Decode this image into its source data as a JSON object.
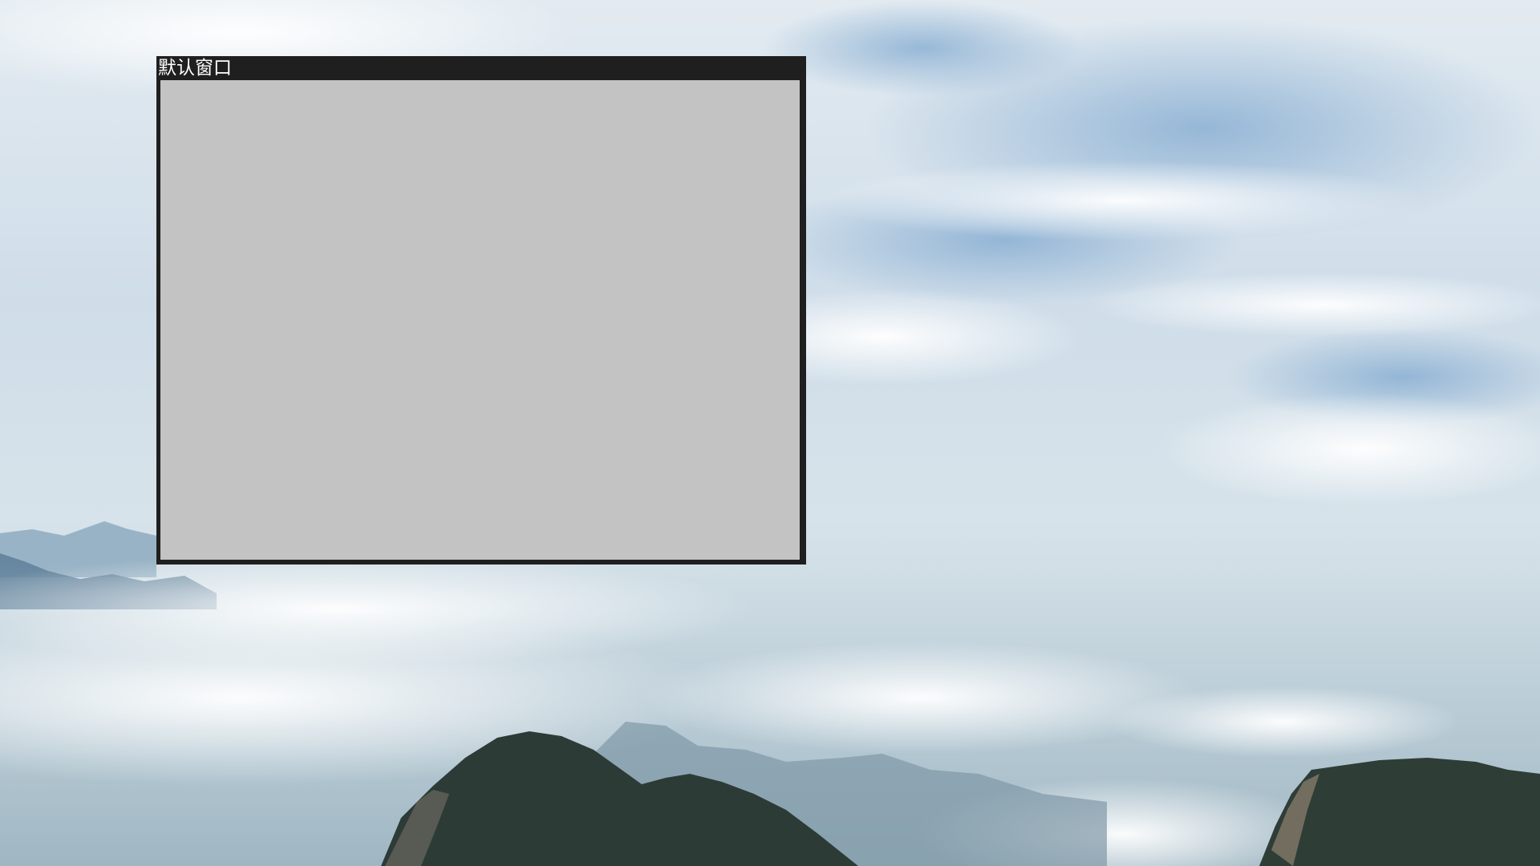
{
  "desktop": {
    "wallpaper": "mountain-clouds-wallpaper"
  },
  "window": {
    "title": "默认窗口",
    "colors": {
      "titlebar": "#1f1f1f",
      "title_text": "#ffffff",
      "client": "#c3c3c3"
    }
  }
}
